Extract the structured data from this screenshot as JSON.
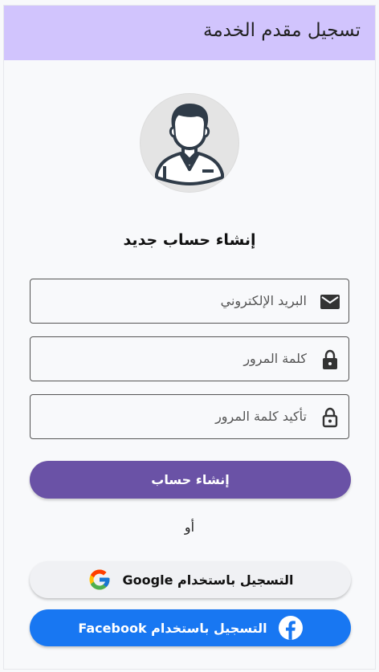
{
  "app_bar": {
    "title": "تسجيل مقدم الخدمة",
    "background": "#d1c4fd"
  },
  "avatar": {
    "icon": "user-avatar-icon"
  },
  "form": {
    "heading": "إنشاء حساب جديد",
    "fields": [
      {
        "placeholder": "البريد الإلكتروني",
        "icon": "email-icon"
      },
      {
        "placeholder": "كلمة المرور",
        "icon": "lock-icon"
      },
      {
        "placeholder": "تأكيد كلمة المرور",
        "icon": "lock-outline-icon"
      }
    ],
    "submit_label": "إنشاء حساب",
    "submit_color": "#6a52a6"
  },
  "divider_text": "أو",
  "social": {
    "google_label": "التسجيل باستخدام Google",
    "facebook_label": "التسجيل باستخدام Facebook",
    "facebook_color": "#1877f2"
  }
}
